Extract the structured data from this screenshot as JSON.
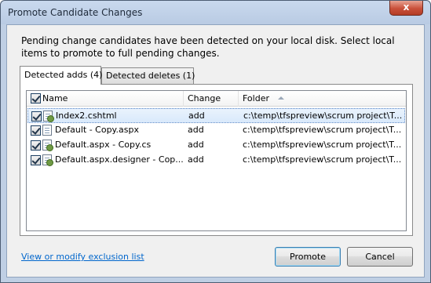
{
  "window": {
    "title": "Promote Candidate Changes",
    "close_glyph": "x"
  },
  "intro_text": "Pending change candidates have been detected on your local disk. Select local items to promote to full pending changes.",
  "tabs": [
    {
      "label": "Detected adds (4)",
      "active": true
    },
    {
      "label": "Detected deletes (1)",
      "active": false
    }
  ],
  "list": {
    "columns": {
      "name": "Name",
      "change": "Change",
      "folder": "Folder"
    },
    "sort": {
      "column": "folder",
      "direction": "ascending"
    },
    "rows": [
      {
        "name": "Index2.cshtml",
        "change": "add",
        "folder": "c:\\temp\\tfspreview\\scrum project\\T...",
        "checked": true,
        "selected": true,
        "icon": "cshtml-file-icon"
      },
      {
        "name": "Default - Copy.aspx",
        "change": "add",
        "folder": "c:\\temp\\tfspreview\\scrum project\\T...",
        "checked": true,
        "selected": false,
        "icon": "aspx-file-icon"
      },
      {
        "name": "Default.aspx - Copy.cs",
        "change": "add",
        "folder": "c:\\temp\\tfspreview\\scrum project\\T...",
        "checked": true,
        "selected": false,
        "icon": "cs-file-icon"
      },
      {
        "name": "Default.aspx.designer - Cop...",
        "change": "add",
        "folder": "c:\\temp\\tfspreview\\scrum project\\T...",
        "checked": true,
        "selected": false,
        "icon": "cs-file-icon"
      }
    ]
  },
  "exclusion_link": "View or modify exclusion list",
  "buttons": {
    "promote": "Promote",
    "cancel": "Cancel"
  },
  "colors": {
    "link": "#0066cc",
    "selection": "#d9e9fb",
    "frame": "#bfcfe4"
  }
}
